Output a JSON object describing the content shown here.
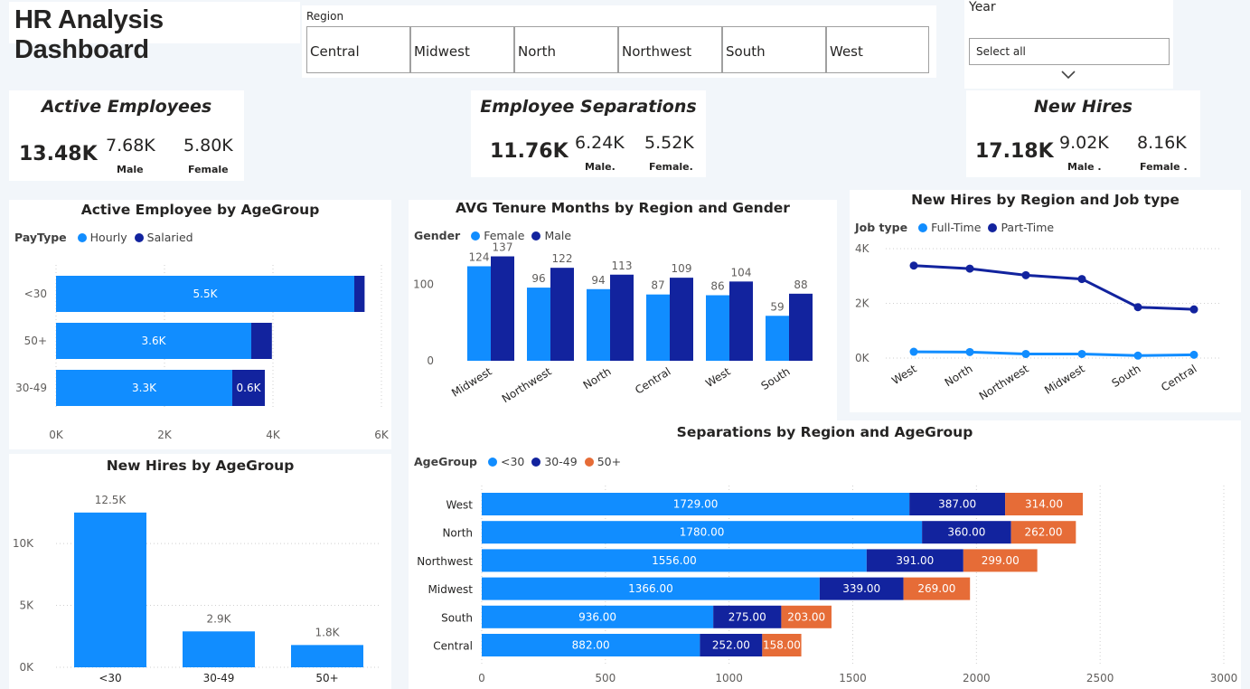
{
  "page_title": "HR Analysis Dashboard",
  "region_slicer": {
    "label": "Region",
    "options": [
      "Central",
      "Midwest",
      "North",
      "Northwest",
      "South",
      "West"
    ]
  },
  "year_slicer": {
    "label": "Year",
    "selected": "Select all"
  },
  "kpis": {
    "active": {
      "title": "Active Employees",
      "total": "13.48K",
      "male": "7.68K",
      "female": "5.80K",
      "male_label": "Male",
      "female_label": "Female"
    },
    "separations": {
      "title": "Employee Separations",
      "total": "11.76K",
      "male": "6.24K",
      "female": "5.52K",
      "male_label": "Male.",
      "female_label": "Female."
    },
    "hires": {
      "title": "New Hires",
      "total": "17.18K",
      "male": "9.02K",
      "female": "8.16K",
      "male_label": "Male .",
      "female_label": "Female ."
    }
  },
  "colors": {
    "light_blue": "#118dff",
    "dark_blue": "#12239e",
    "orange": "#e66c37",
    "background": "#f2f6fa"
  },
  "chart_data": [
    {
      "id": "active_by_agegroup",
      "type": "bar",
      "orientation": "horizontal",
      "stacked": true,
      "title": "Active Employee by AgeGroup",
      "legend_title": "PayType",
      "categories": [
        "<30",
        "50+",
        "30-49"
      ],
      "series": [
        {
          "name": "Hourly",
          "values": [
            5500,
            3600,
            3250
          ],
          "labels": [
            "5.5K",
            "3.6K",
            "3.3K"
          ]
        },
        {
          "name": "Salaried",
          "values": [
            190,
            380,
            600
          ],
          "labels": [
            "",
            "",
            "0.6K"
          ]
        }
      ],
      "xlim": [
        0,
        6000
      ],
      "ticks": [
        "0K",
        "2K",
        "4K",
        "6K"
      ],
      "grid": true
    },
    {
      "id": "tenure_by_region_gender",
      "type": "bar",
      "orientation": "vertical",
      "title": "AVG Tenure Months by Region and Gender",
      "legend_title": "Gender",
      "categories": [
        "Midwest",
        "Northwest",
        "North",
        "Central",
        "West",
        "South"
      ],
      "series": [
        {
          "name": "Female",
          "values": [
            124,
            96,
            94,
            87,
            86,
            59
          ]
        },
        {
          "name": "Male",
          "values": [
            137,
            122,
            113,
            109,
            104,
            88
          ]
        }
      ],
      "ylim": [
        0,
        140
      ],
      "ticks": [
        "0",
        "100"
      ]
    },
    {
      "id": "hires_by_region_jobtype",
      "type": "line",
      "title": "New Hires by Region and Job type",
      "legend_title": "Job type",
      "categories": [
        "West",
        "North",
        "Northwest",
        "Midwest",
        "South",
        "Central"
      ],
      "series": [
        {
          "name": "Full-Time",
          "values": [
            230,
            220,
            150,
            150,
            90,
            120
          ]
        },
        {
          "name": "Part-Time",
          "values": [
            3380,
            3270,
            3030,
            2890,
            1860,
            1780
          ]
        }
      ],
      "ylim": [
        0,
        4000
      ],
      "ticks": [
        "0K",
        "2K",
        "4K"
      ],
      "grid": true
    },
    {
      "id": "hires_by_agegroup",
      "type": "bar",
      "orientation": "vertical",
      "title": "New Hires by AgeGroup",
      "categories": [
        "<30",
        "30-49",
        "50+"
      ],
      "values": [
        12500,
        2900,
        1800
      ],
      "labels": [
        "12.5K",
        "2.9K",
        "1.8K"
      ],
      "ylim": [
        0,
        13000
      ],
      "ticks": [
        "0K",
        "5K",
        "10K"
      ],
      "grid": true
    },
    {
      "id": "separations_by_region_agegroup",
      "type": "bar",
      "orientation": "horizontal",
      "stacked": true,
      "title": "Separations by Region and AgeGroup",
      "legend_title": "AgeGroup",
      "categories": [
        "West",
        "North",
        "Northwest",
        "Midwest",
        "South",
        "Central"
      ],
      "series": [
        {
          "name": "<30",
          "values": [
            1729,
            1780,
            1556,
            1366,
            936,
            882
          ],
          "labels": [
            "1729.00",
            "1780.00",
            "1556.00",
            "1366.00",
            "936.00",
            "882.00"
          ]
        },
        {
          "name": "30-49",
          "values": [
            387,
            360,
            391,
            339,
            275,
            252
          ],
          "labels": [
            "387.00",
            "360.00",
            "391.00",
            "339.00",
            "275.00",
            "252.00"
          ]
        },
        {
          "name": "50+",
          "values": [
            314,
            262,
            299,
            269,
            203,
            158
          ],
          "labels": [
            "314.00",
            "262.00",
            "299.00",
            "269.00",
            "203.00",
            "158.00"
          ]
        }
      ],
      "xlim": [
        0,
        3000
      ],
      "ticks": [
        "0",
        "500",
        "1000",
        "1500",
        "2000",
        "2500",
        "3000"
      ],
      "grid": true
    }
  ]
}
